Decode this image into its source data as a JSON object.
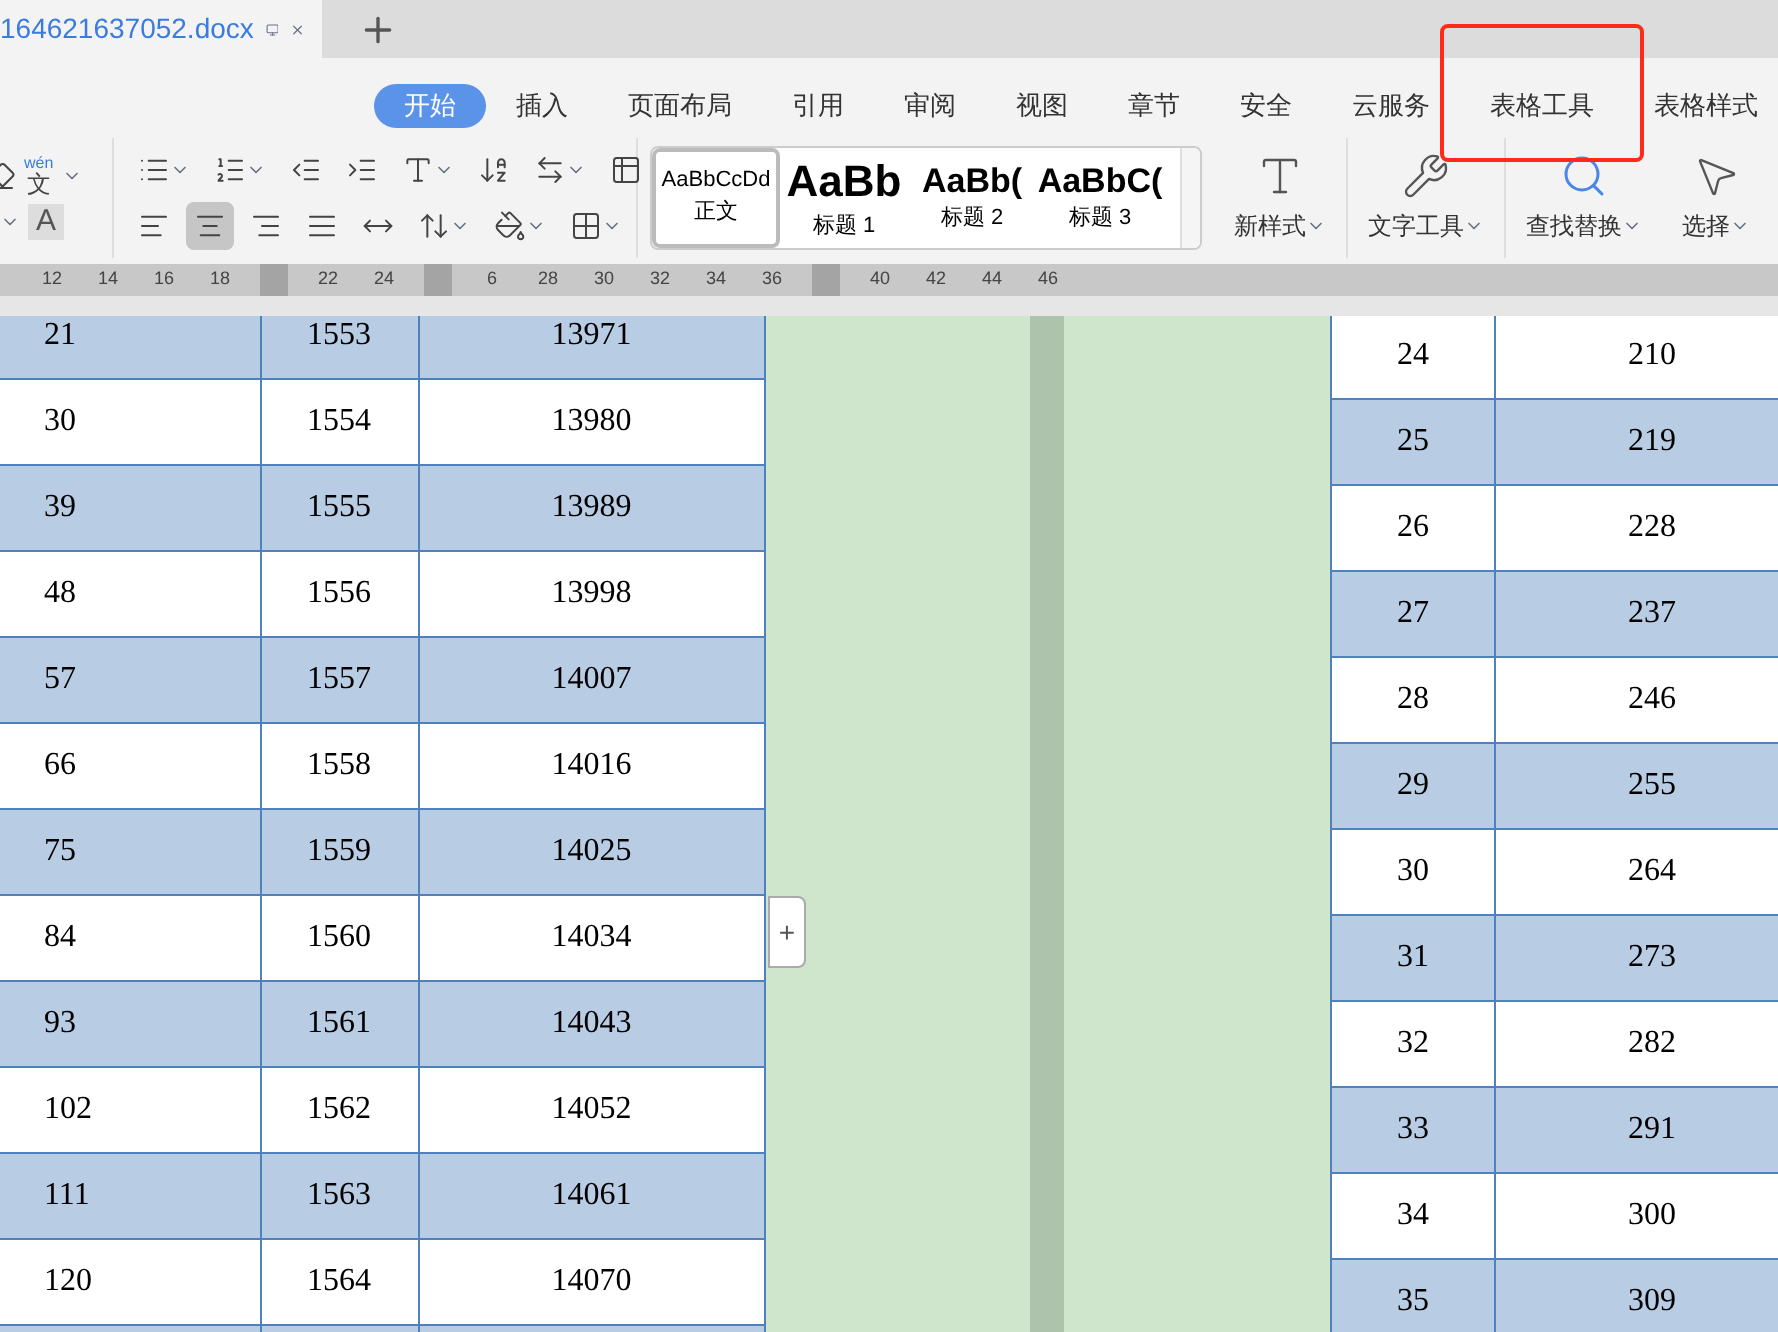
{
  "document_tab": {
    "title": "164621637052.docx"
  },
  "menu_tabs": [
    {
      "label": "开始",
      "selected": true,
      "annotated": false
    },
    {
      "label": "插入",
      "selected": false,
      "annotated": false
    },
    {
      "label": "页面布局",
      "selected": false,
      "annotated": false
    },
    {
      "label": "引用",
      "selected": false,
      "annotated": false
    },
    {
      "label": "审阅",
      "selected": false,
      "annotated": false
    },
    {
      "label": "视图",
      "selected": false,
      "annotated": false
    },
    {
      "label": "章节",
      "selected": false,
      "annotated": false
    },
    {
      "label": "安全",
      "selected": false,
      "annotated": false
    },
    {
      "label": "云服务",
      "selected": false,
      "annotated": false
    },
    {
      "label": "表格工具",
      "selected": false,
      "annotated": true
    },
    {
      "label": "表格样式",
      "selected": false,
      "annotated": false
    }
  ],
  "pinyin_button": {
    "ruby": "wén",
    "char": "文"
  },
  "char_shading_button": {
    "char": "A"
  },
  "styles": [
    {
      "sample": "AaBbCcDd",
      "label": "正文",
      "selected": true
    },
    {
      "sample": "AaBb",
      "label": "标题 1",
      "selected": false
    },
    {
      "sample": "AaBb(",
      "label": "标题 2",
      "selected": false
    },
    {
      "sample": "AaBbC(",
      "label": "标题 3",
      "selected": false
    }
  ],
  "tools": [
    {
      "kind": "newstyle",
      "label": "新样式"
    },
    {
      "kind": "texttool",
      "label": "文字工具"
    },
    {
      "kind": "find",
      "label": "查找替换"
    },
    {
      "kind": "select",
      "label": "选择"
    }
  ],
  "ruler": [
    {
      "kind": "number",
      "text": "12"
    },
    {
      "kind": "number",
      "text": "14"
    },
    {
      "kind": "number",
      "text": "16"
    },
    {
      "kind": "number",
      "text": "18"
    },
    {
      "kind": "marker"
    },
    {
      "kind": "number",
      "text": "22"
    },
    {
      "kind": "number",
      "text": "24"
    },
    {
      "kind": "marker"
    },
    {
      "kind": "number",
      "text": "6"
    },
    {
      "kind": "number",
      "text": "28"
    },
    {
      "kind": "number",
      "text": "30"
    },
    {
      "kind": "number",
      "text": "32"
    },
    {
      "kind": "number",
      "text": "34"
    },
    {
      "kind": "number",
      "text": "36"
    },
    {
      "kind": "marker"
    },
    {
      "kind": "number",
      "text": "40"
    },
    {
      "kind": "number",
      "text": "42"
    },
    {
      "kind": "number",
      "text": "44"
    },
    {
      "kind": "number",
      "text": "46"
    }
  ],
  "left_table": {
    "rows": [
      {
        "cells": [
          "21",
          "1553",
          "13971"
        ],
        "shaded": true
      },
      {
        "cells": [
          "30",
          "1554",
          "13980"
        ],
        "shaded": false
      },
      {
        "cells": [
          "39",
          "1555",
          "13989"
        ],
        "shaded": true
      },
      {
        "cells": [
          "48",
          "1556",
          "13998"
        ],
        "shaded": false
      },
      {
        "cells": [
          "57",
          "1557",
          "14007"
        ],
        "shaded": true
      },
      {
        "cells": [
          "66",
          "1558",
          "14016"
        ],
        "shaded": false
      },
      {
        "cells": [
          "75",
          "1559",
          "14025"
        ],
        "shaded": true
      },
      {
        "cells": [
          "84",
          "1560",
          "14034"
        ],
        "shaded": false
      },
      {
        "cells": [
          "93",
          "1561",
          "14043"
        ],
        "shaded": true
      },
      {
        "cells": [
          "102",
          "1562",
          "14052"
        ],
        "shaded": false
      },
      {
        "cells": [
          "111",
          "1563",
          "14061"
        ],
        "shaded": true
      },
      {
        "cells": [
          "120",
          "1564",
          "14070"
        ],
        "shaded": false
      }
    ]
  },
  "add_row_button": {
    "label": "+"
  },
  "right_table": {
    "rows": [
      {
        "cells": [
          "24",
          "210"
        ],
        "shaded": false
      },
      {
        "cells": [
          "25",
          "219"
        ],
        "shaded": true
      },
      {
        "cells": [
          "26",
          "228"
        ],
        "shaded": false
      },
      {
        "cells": [
          "27",
          "237"
        ],
        "shaded": true
      },
      {
        "cells": [
          "28",
          "246"
        ],
        "shaded": false
      },
      {
        "cells": [
          "29",
          "255"
        ],
        "shaded": true
      },
      {
        "cells": [
          "30",
          "264"
        ],
        "shaded": false
      },
      {
        "cells": [
          "31",
          "273"
        ],
        "shaded": true
      },
      {
        "cells": [
          "32",
          "282"
        ],
        "shaded": false
      },
      {
        "cells": [
          "33",
          "291"
        ],
        "shaded": true
      },
      {
        "cells": [
          "34",
          "300"
        ],
        "shaded": false
      },
      {
        "cells": [
          "35",
          "309"
        ],
        "shaded": true
      }
    ]
  }
}
